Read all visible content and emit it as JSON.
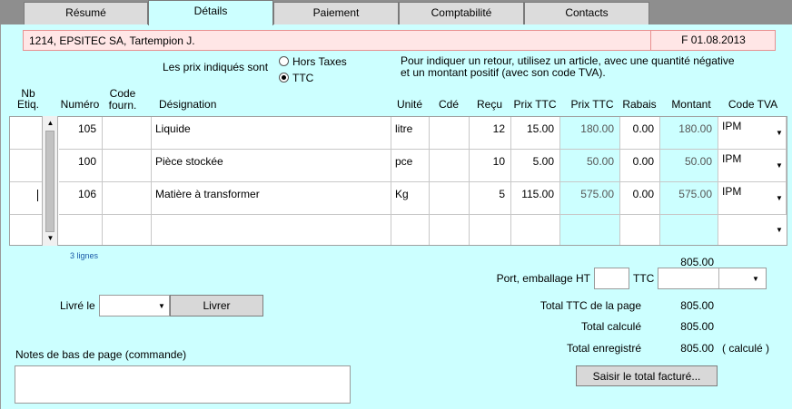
{
  "tabs": [
    {
      "label": "Résumé"
    },
    {
      "label": "Détails"
    },
    {
      "label": "Paiement"
    },
    {
      "label": "Comptabilité"
    },
    {
      "label": "Contacts"
    }
  ],
  "client": {
    "name": "1214, EPSITEC SA, Tartempion J.",
    "document": "F 01.08.2013"
  },
  "prices": {
    "label": "Les prix indiqués sont",
    "option_ht": "Hors Taxes",
    "option_ttc": "TTC",
    "selected": "TTC"
  },
  "hint": "Pour indiquer un retour, utilisez un article, avec une quantité négative\net un montant positif (avec son code TVA).",
  "columns": {
    "nb": "Nb",
    "etiq": "Etiq.",
    "numero": "Numéro",
    "code": "Code\nfourn.",
    "designation": "Désignation",
    "unite": "Unité",
    "cde": "Cdé",
    "recu": "Reçu",
    "prix_ttc": "Prix TTC",
    "prix_ttc2": "Prix TTC",
    "rabais": "Rabais",
    "montant": "Montant",
    "code_tva": "Code TVA"
  },
  "rows": [
    {
      "numero": "105",
      "designation": "Liquide",
      "unite": "litre",
      "recu": "12",
      "prix": "15.00",
      "prix_calc": "180.00",
      "rabais": "0.00",
      "montant": "180.00",
      "tva": "IPM"
    },
    {
      "numero": "100",
      "designation": "Pièce stockée",
      "unite": "pce",
      "recu": "10",
      "prix": "5.00",
      "prix_calc": "50.00",
      "rabais": "0.00",
      "montant": "50.00",
      "tva": "IPM"
    },
    {
      "numero": "106",
      "designation": "Matière à transformer",
      "unite": "Kg",
      "recu": "5",
      "prix": "115.00",
      "prix_calc": "575.00",
      "rabais": "0.00",
      "montant": "575.00",
      "tva": "IPM"
    }
  ],
  "line_count": "3 lignes",
  "totals": {
    "subtotal": "805.00",
    "port_label": "Port, emballage HT",
    "ttc_label": "TTC",
    "page_label": "Total TTC de la page",
    "page_value": "805.00",
    "calc_label": "Total calculé",
    "calc_value": "805.00",
    "reg_label": "Total enregistré",
    "reg_value": "805.00",
    "reg_note": "( calculé )",
    "enter_total_button": "Saisir le total facturé..."
  },
  "delivery": {
    "label": "Livré le",
    "value": "",
    "button": "Livrer"
  },
  "notes": {
    "label": "Notes de bas de page (commande)",
    "value": ""
  }
}
